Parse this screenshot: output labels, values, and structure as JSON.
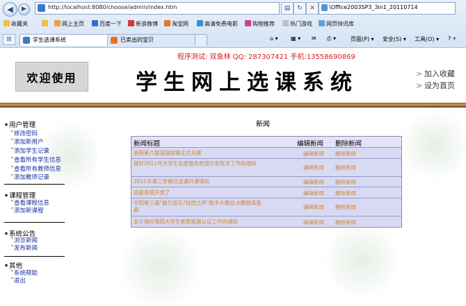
{
  "browser": {
    "url": "http://localhost:8080/choose/admin/index.htm",
    "search_text": "\\Office2003SP3_3in1_20110714",
    "favorites_label": "收藏夹",
    "favorites": [
      "网上主页",
      "百度一下",
      "新浪微博",
      "淘宝网",
      "高清免费电影",
      "购物推荐",
      "热门游戏",
      "网页快讯库"
    ],
    "tabs": [
      {
        "label": "学生选课系统",
        "active": true
      },
      {
        "label": "已卖出的宝贝",
        "active": false
      }
    ],
    "tools": [
      "页面(P)",
      "安全(S)",
      "工具(O)"
    ],
    "help_label": "?"
  },
  "header": {
    "welcome": "欢迎使用",
    "contact": "程序测试: 双鱼林 QQ: 287307421 手机:13558690869",
    "system_title": "学生网上选课系统",
    "links": [
      "加入收藏",
      "设为首页"
    ]
  },
  "sidebar": {
    "sections": [
      {
        "title": "用户管理",
        "items": [
          "修改密码",
          "添加新用户",
          "添加学生记录",
          "查看所有学生信息",
          "查看所有教师信息",
          "添加教师记录"
        ]
      },
      {
        "title": "课程管理",
        "items": [
          "查看课程信息",
          "添加新课程"
        ]
      },
      {
        "title": "系统公告",
        "items": [
          "浏览新闻",
          "发布新闻"
        ]
      },
      {
        "title": "其他",
        "items": [
          "系统帮助",
          "退出"
        ]
      }
    ]
  },
  "content": {
    "title": "新闻",
    "columns": [
      "新闻标题",
      "编辑新闻",
      "删除新闻"
    ],
    "edit_label": "编辑新闻",
    "delete_label": "删除新闻",
    "rows": [
      {
        "title": "我院第六届篮球联赛正式开赛"
      },
      {
        "title": "做好2011年大学生志愿服务西部计划有关工作的通知"
      },
      {
        "title": "2011年第二学期任选课开课通知"
      },
      {
        "title": "选题系统开放了"
      },
      {
        "title": "学院第三届\"魅力音乐?校园之声\"歌手大赛总决赛圆满落幕"
      },
      {
        "title": "关于做好我院大学生素质拓展认证工作的通知"
      }
    ]
  }
}
